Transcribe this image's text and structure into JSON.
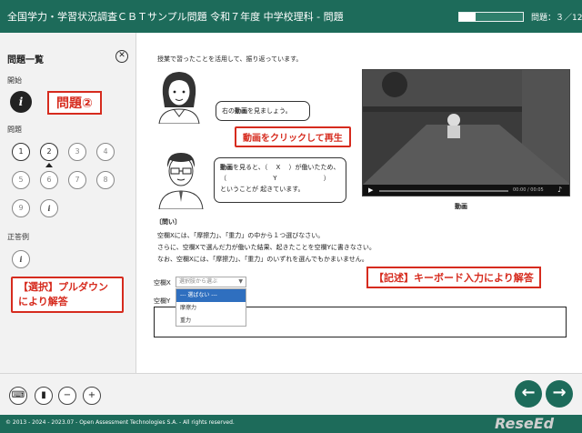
{
  "header": {
    "title": "全国学力・学習状況調査ＣＢＴサンプル問題 令和７年度 中学校理科 - 問題",
    "progress": 0.25,
    "counter": "問題：３／12"
  },
  "sidebar": {
    "title": "問題一覧",
    "section_start": "開始",
    "section_questions": "問題",
    "section_answers": "正答例",
    "info_glyph": "i",
    "questions": [
      "1",
      "2",
      "3",
      "4",
      "5",
      "6",
      "7",
      "8",
      "9",
      "i"
    ],
    "current_index": 1
  },
  "callouts": {
    "mondai": "問題②",
    "video": "動画をクリックして再生",
    "select": "【選択】プルダウン\nにより解答",
    "keyboard": "【記述】キーボード入力により解答"
  },
  "content": {
    "intro": "授業で習ったことを活用して、振り返っています。",
    "bubble1_pre": "右の",
    "bubble1_bold": "動画",
    "bubble1_post": "を見ましょう。",
    "bubble2_line1_bold": "動画",
    "bubble2_line1": "を見ると、（　 X 　）が働いたため、",
    "bubble2_line2": "（　　　　　　　 Y 　　　　　　　）",
    "bubble2_line3": "ということが 起きています。",
    "video_time": "00:00 / 00:05",
    "video_caption": "動画",
    "question_head": "〔問い〕",
    "q_line1": "空欄Xには、「摩擦力」、「重力」の中から１つ選びなさい。",
    "q_line2": "さらに、空欄Xで選んだ力が働いた結果、起きたことを空欄Yに書きなさい。",
    "q_line3": "なお、空欄Xには、「摩擦力」、「重力」のいずれを選んでもかまいません。",
    "label_x": "空欄X",
    "label_y": "空欄Y",
    "select_placeholder": "選択肢から選ぶ",
    "dropdown_options": [
      "--- 選ばない ---",
      "摩擦力",
      "重力"
    ],
    "answer_y_value": ""
  },
  "toolbar": {
    "prev": "←",
    "next": "→"
  },
  "footer": {
    "copyright": "© 2013 - 2024 - 2023.07 - Open Assessment Technologies S.A. - All rights reserved.",
    "logo": "ReseEd"
  },
  "colors": {
    "brand": "#1d6b5a",
    "callout": "#d62b1e",
    "selection": "#2f6fbf"
  },
  "icons": [
    "close-icon",
    "info-icon",
    "screen-reader-icon",
    "bookmark-icon",
    "zoom-out-icon",
    "zoom-in-icon",
    "arrow-left-icon",
    "arrow-right-icon",
    "play-icon",
    "music-icon"
  ]
}
